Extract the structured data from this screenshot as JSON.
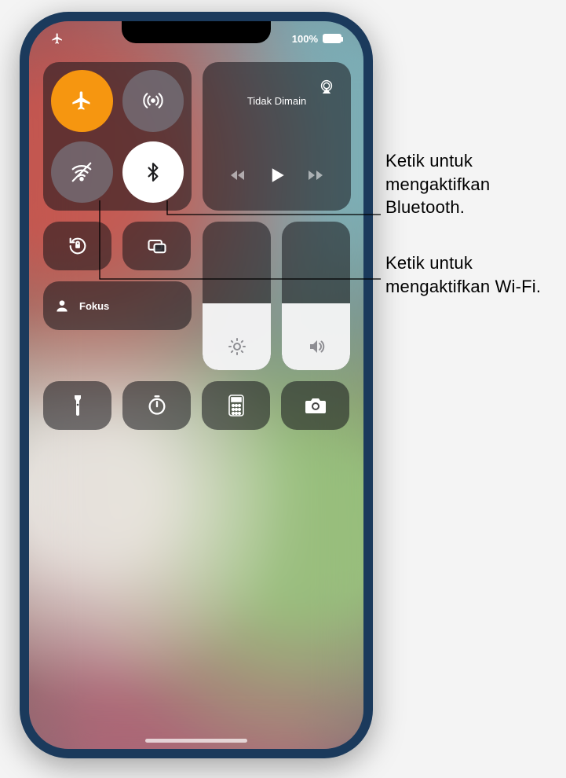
{
  "status": {
    "battery_pct": "100%"
  },
  "media": {
    "title": "Tidak Dimain"
  },
  "focus": {
    "label": "Fokus"
  },
  "sliders": {
    "brightness_pct": 45,
    "volume_pct": 45
  },
  "callouts": {
    "bluetooth": "Ketik untuk mengaktifkan Bluetooth.",
    "wifi": "Ketik untuk mengaktifkan Wi-Fi."
  },
  "colors": {
    "active_orange": "#ff9500"
  }
}
